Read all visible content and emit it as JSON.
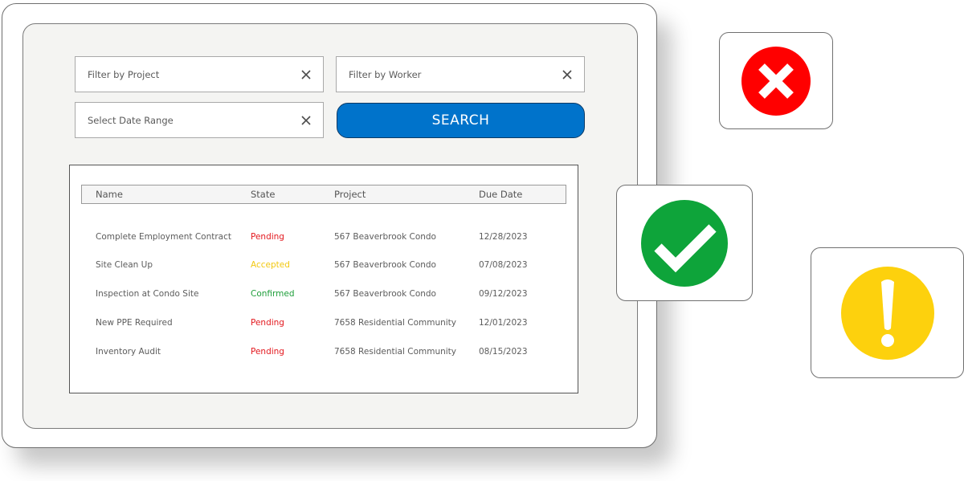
{
  "filters": {
    "project": {
      "placeholder": "Filter by Project",
      "value": "",
      "clear_icon": "close-icon"
    },
    "worker": {
      "placeholder": "Filter by Worker",
      "value": "",
      "clear_icon": "close-icon"
    },
    "date_range": {
      "placeholder": "Select Date Range",
      "value": "",
      "clear_icon": "close-icon"
    },
    "search_label": "SEARCH"
  },
  "colors": {
    "search_button": "#0073cb",
    "pending": "#e3191f",
    "accepted": "#f2c811",
    "confirmed": "#1e9e3a",
    "error_icon": "#ff0000",
    "success_icon": "#0ea43a",
    "warning_icon": "#fdd10d"
  },
  "table": {
    "columns": [
      "Name",
      "State",
      "Project",
      "Due Date"
    ],
    "rows": [
      {
        "name": "Complete Employment Contract",
        "state": "Pending",
        "state_type": "pending",
        "project": "567 Beaverbrook Condo",
        "due_date": "12/28/2023"
      },
      {
        "name": "Site Clean Up",
        "state": "Accepted",
        "state_type": "accepted",
        "project": "567 Beaverbrook Condo",
        "due_date": "07/08/2023"
      },
      {
        "name": "Inspection at Condo Site",
        "state": "Confirmed",
        "state_type": "confirmed",
        "project": "567 Beaverbrook Condo",
        "due_date": "09/12/2023"
      },
      {
        "name": "New PPE Required",
        "state": "Pending",
        "state_type": "pending",
        "project": "7658 Residential Community",
        "due_date": "12/01/2023"
      },
      {
        "name": "Inventory Audit",
        "state": "Pending",
        "state_type": "pending",
        "project": "7658 Residential Community",
        "due_date": "08/15/2023"
      }
    ]
  },
  "status_cards": [
    {
      "icon": "error-x-icon"
    },
    {
      "icon": "success-check-icon"
    },
    {
      "icon": "warning-exclamation-icon"
    }
  ]
}
